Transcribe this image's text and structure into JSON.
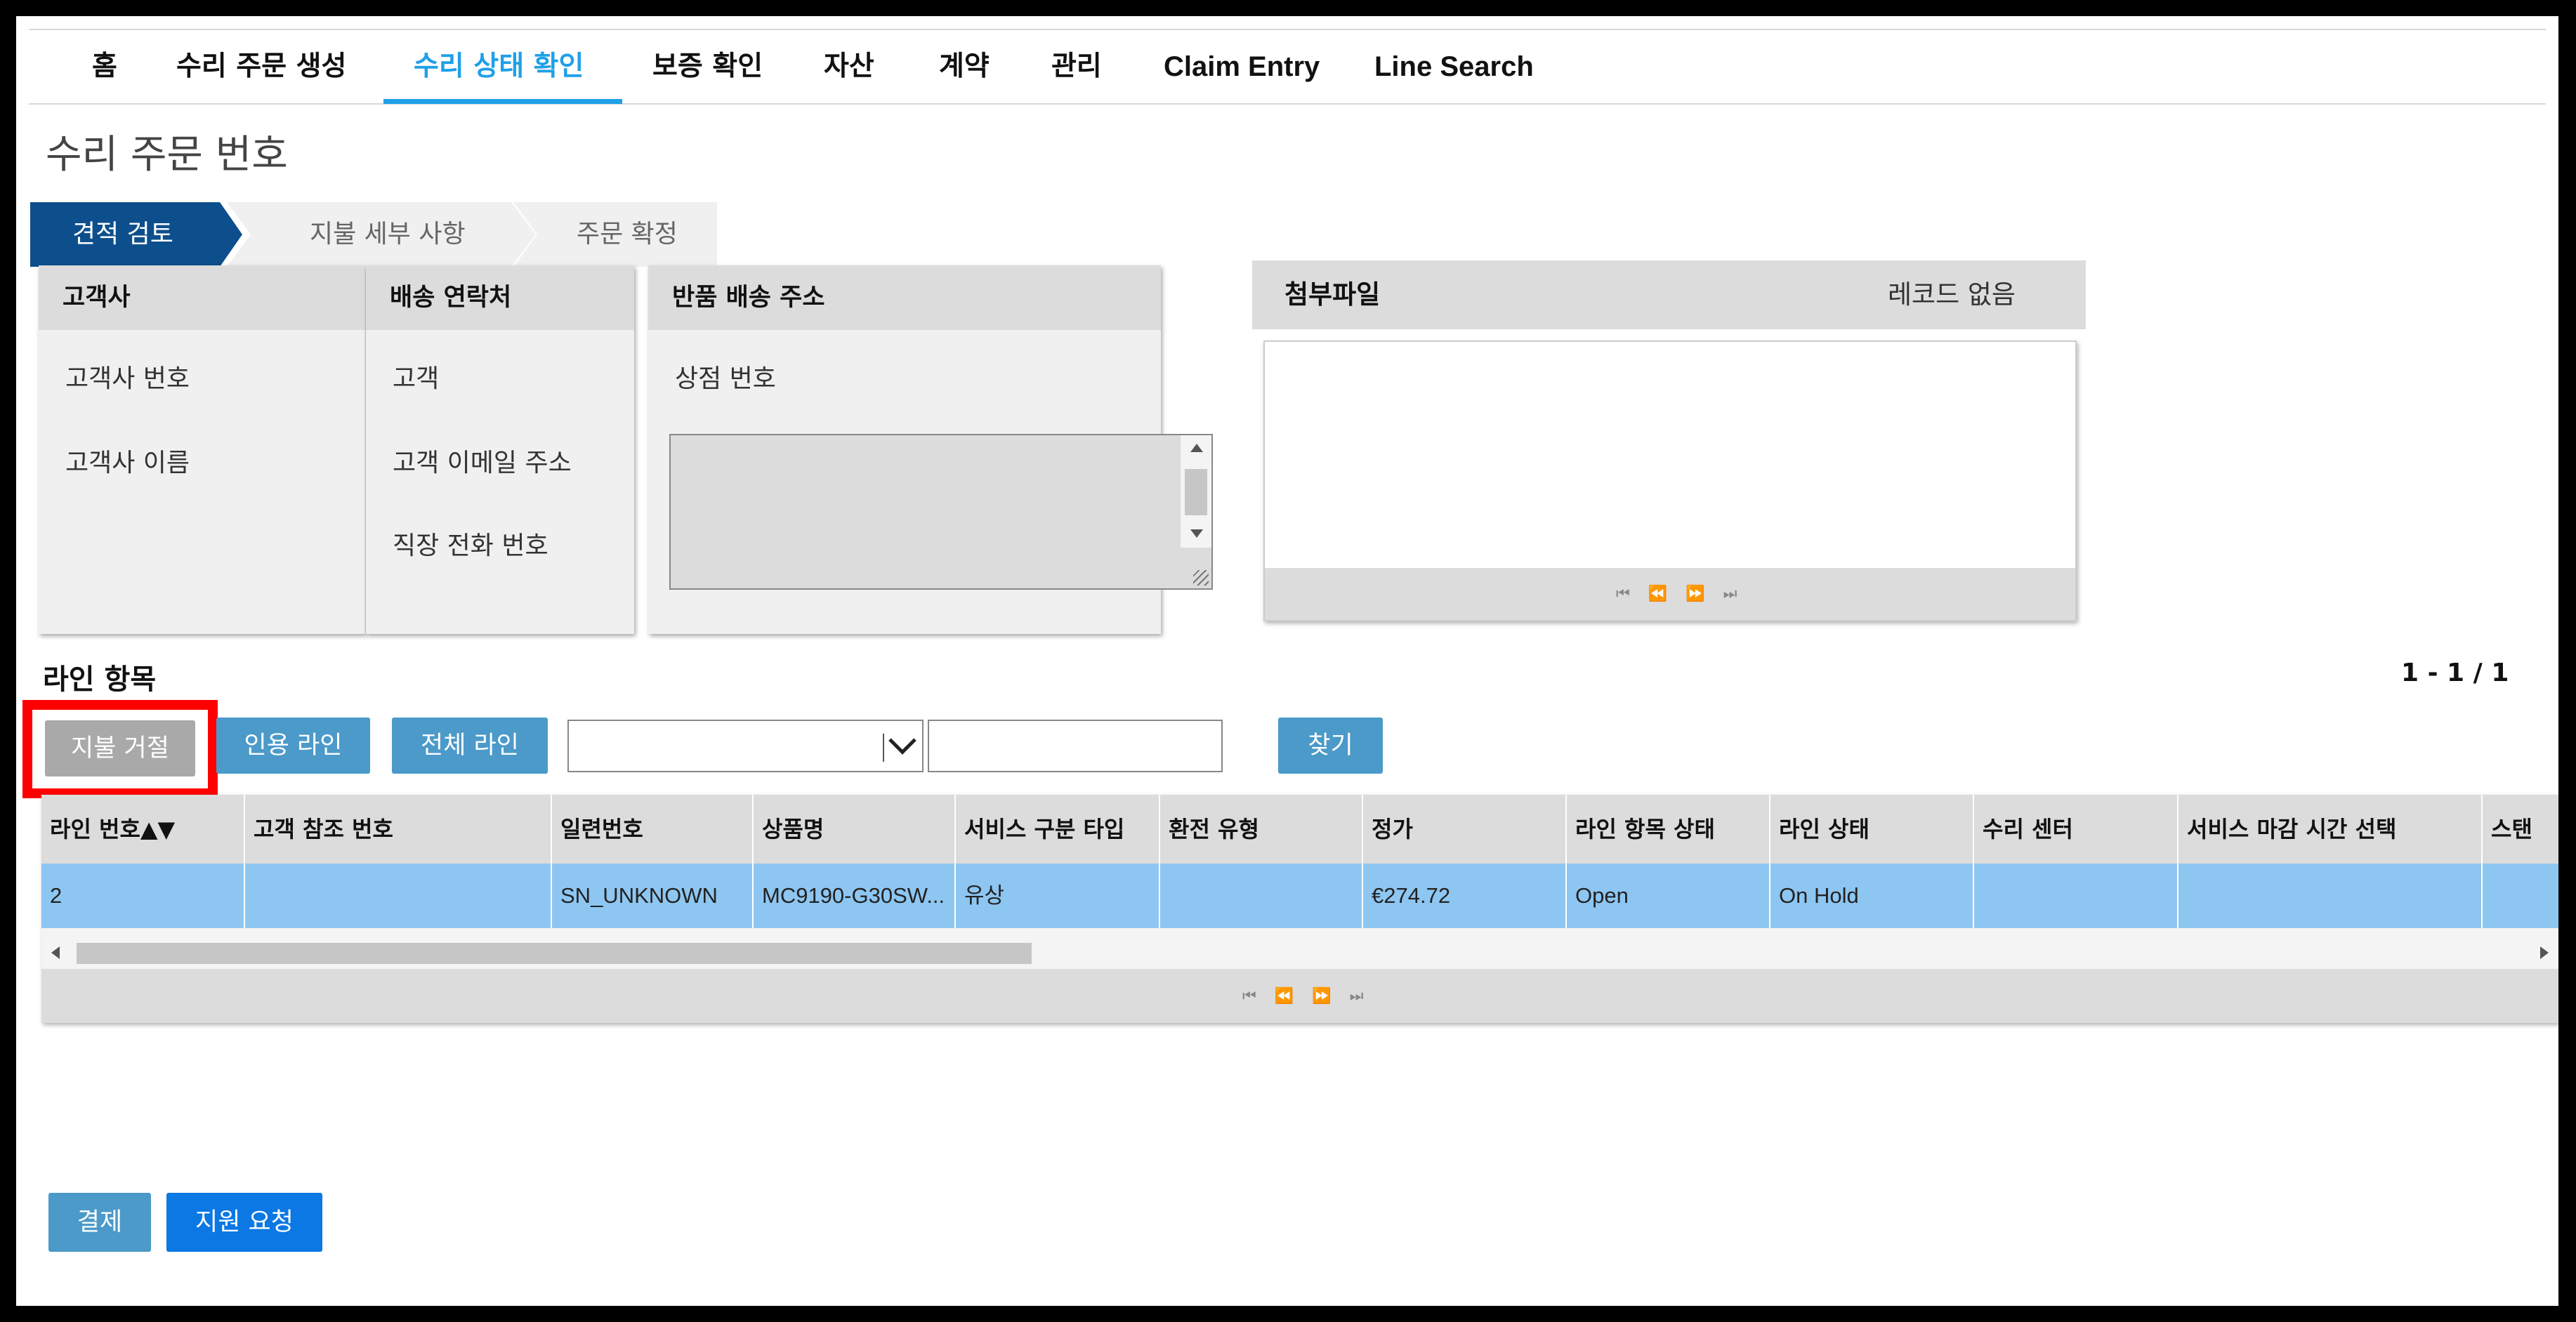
{
  "nav": {
    "items": [
      {
        "label": "홈"
      },
      {
        "label": "수리 주문 생성"
      },
      {
        "label": "수리 상태 확인"
      },
      {
        "label": "보증 확인"
      },
      {
        "label": "자산"
      },
      {
        "label": "계약"
      },
      {
        "label": "관리"
      },
      {
        "label": "Claim Entry"
      },
      {
        "label": "Line Search"
      }
    ],
    "active_index": 2,
    "active_color": "#1fa0e8"
  },
  "page_title": "수리 주문 번호",
  "steps": [
    "견적 검토",
    "지불 세부 사항",
    "주문 확정"
  ],
  "panels": {
    "customer": {
      "title": "고객사",
      "fields": [
        "고객사 번호",
        "고객사 이름"
      ]
    },
    "shipping": {
      "title": "배송 연락처",
      "fields": [
        "고객",
        "고객 이메일 주소",
        "직장 전화 번호"
      ]
    },
    "return": {
      "title": "반품 배송 주소",
      "fields": [
        "상점 번호"
      ]
    },
    "attachments": {
      "title": "첨부파일",
      "empty_text": "레코드 없음"
    }
  },
  "lines": {
    "title": "라인 항목",
    "count": "1 - 1 / 1",
    "buttons": {
      "reject": "지불 거절",
      "quote": "인용 라인",
      "all": "전체 라인",
      "find": "찾기"
    },
    "filter_value": "",
    "search_value": "",
    "columns": [
      "라인 번호▲▼",
      "고객 참조 번호",
      "일련번호",
      "상품명",
      "서비스 구분 타입",
      "환전 유형",
      "정가",
      "라인 항목 상태",
      "라인 상태",
      "수리 센터",
      "서비스 마감 시간 선택",
      "스탠"
    ],
    "rows": [
      [
        "2",
        "",
        "SN_UNKNOWN",
        "MC9190-G30SW...",
        "유상",
        "",
        "€274.72",
        "Open",
        "On Hold",
        "",
        "",
        ""
      ]
    ]
  },
  "footer": {
    "pay": "결제",
    "support": "지원 요청"
  },
  "colors": {
    "brand_dark": "#0d4f8c",
    "button_blue": "#4b9ac9",
    "primary_blue": "#0b78e3",
    "selected_row": "#8ec6f2",
    "highlight_red": "#ff0000"
  },
  "icons": {
    "pager": [
      "first-page-icon",
      "prev-page-icon",
      "next-page-icon",
      "last-page-icon"
    ]
  }
}
